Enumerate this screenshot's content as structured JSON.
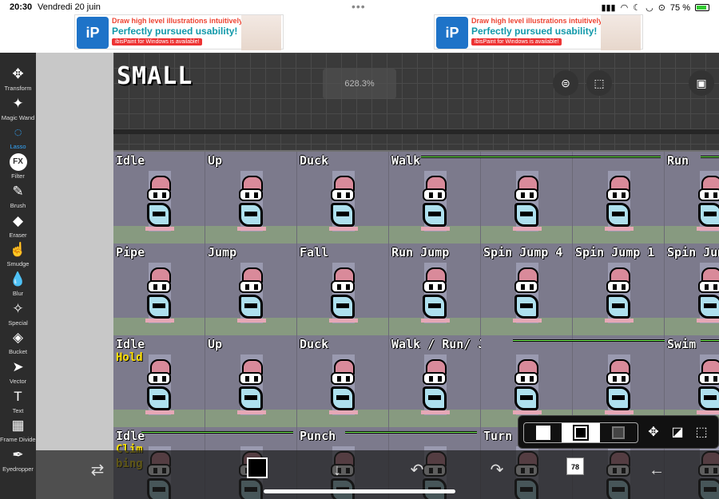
{
  "status": {
    "time": "20:30",
    "date": "Vendredi 20 juin",
    "battery": "75 %",
    "dots": "•••"
  },
  "ads": [
    {
      "logo": "iP",
      "line1": "Draw high level illustrations intuitively!",
      "line2": "Perfectly pursued usability!",
      "line3": "ibisPaint for Windows is available!"
    },
    {
      "logo": "iP",
      "line1": "Draw high level illustrations intuitively!",
      "line2": "Perfectly pursued usability!",
      "line3": "ibisPaint for Windows is available!"
    }
  ],
  "toolbar": {
    "tools": [
      {
        "label": "Transform",
        "icon": "move-icon",
        "glyph": "✥"
      },
      {
        "label": "Magic Wand",
        "icon": "magic-wand-icon",
        "glyph": "✦"
      },
      {
        "label": "Lasso",
        "icon": "lasso-icon",
        "glyph": "◌",
        "active": true
      },
      {
        "label": "Filter",
        "icon": "fx-icon",
        "glyph": "FX"
      },
      {
        "label": "Brush",
        "icon": "brush-icon",
        "glyph": "✎"
      },
      {
        "label": "Eraser",
        "icon": "eraser-icon",
        "glyph": "◆"
      },
      {
        "label": "Smudge",
        "icon": "smudge-icon",
        "glyph": "☝"
      },
      {
        "label": "Blur",
        "icon": "blur-icon",
        "glyph": "💧"
      },
      {
        "label": "Special",
        "icon": "special-icon",
        "glyph": "✧"
      },
      {
        "label": "Bucket",
        "icon": "bucket-icon",
        "glyph": "◈"
      },
      {
        "label": "Vector",
        "icon": "vector-icon",
        "glyph": "➤"
      },
      {
        "label": "Text",
        "icon": "text-icon",
        "glyph": "T"
      },
      {
        "label": "Frame Divider",
        "icon": "frame-divider-icon",
        "glyph": "▦"
      },
      {
        "label": "Eyedropper",
        "icon": "eyedropper-icon",
        "glyph": "✒"
      }
    ]
  },
  "canvas": {
    "title": "SMALL",
    "zoom": "628.3%",
    "rows": [
      {
        "labels": [
          "Idle",
          "Up",
          "Duck",
          "Walk",
          "",
          "",
          "Run"
        ]
      },
      {
        "labels": [
          "Pipe",
          "Jump",
          "Fall",
          "Run Jump",
          "Spin Jump 4",
          "Spin Jump 1",
          "Spin Jum"
        ]
      },
      {
        "labels": [
          "Idle",
          "Up",
          "Duck",
          "Walk / Run/ Jump",
          "",
          "",
          "Swim"
        ],
        "sub": "Hold"
      },
      {
        "labels": [
          "Idle",
          "",
          "Punch",
          "",
          "Turn",
          "",
          ""
        ],
        "sub": "Clim",
        "sub2": "bing"
      }
    ]
  },
  "popup": {
    "move": "✥",
    "transform": "◪",
    "deselect": "⬚"
  },
  "bottombar": {
    "layer_count": "78",
    "swap": "⇄",
    "down": "↓",
    "undo": "↶",
    "redo": "↷",
    "back": "←"
  }
}
